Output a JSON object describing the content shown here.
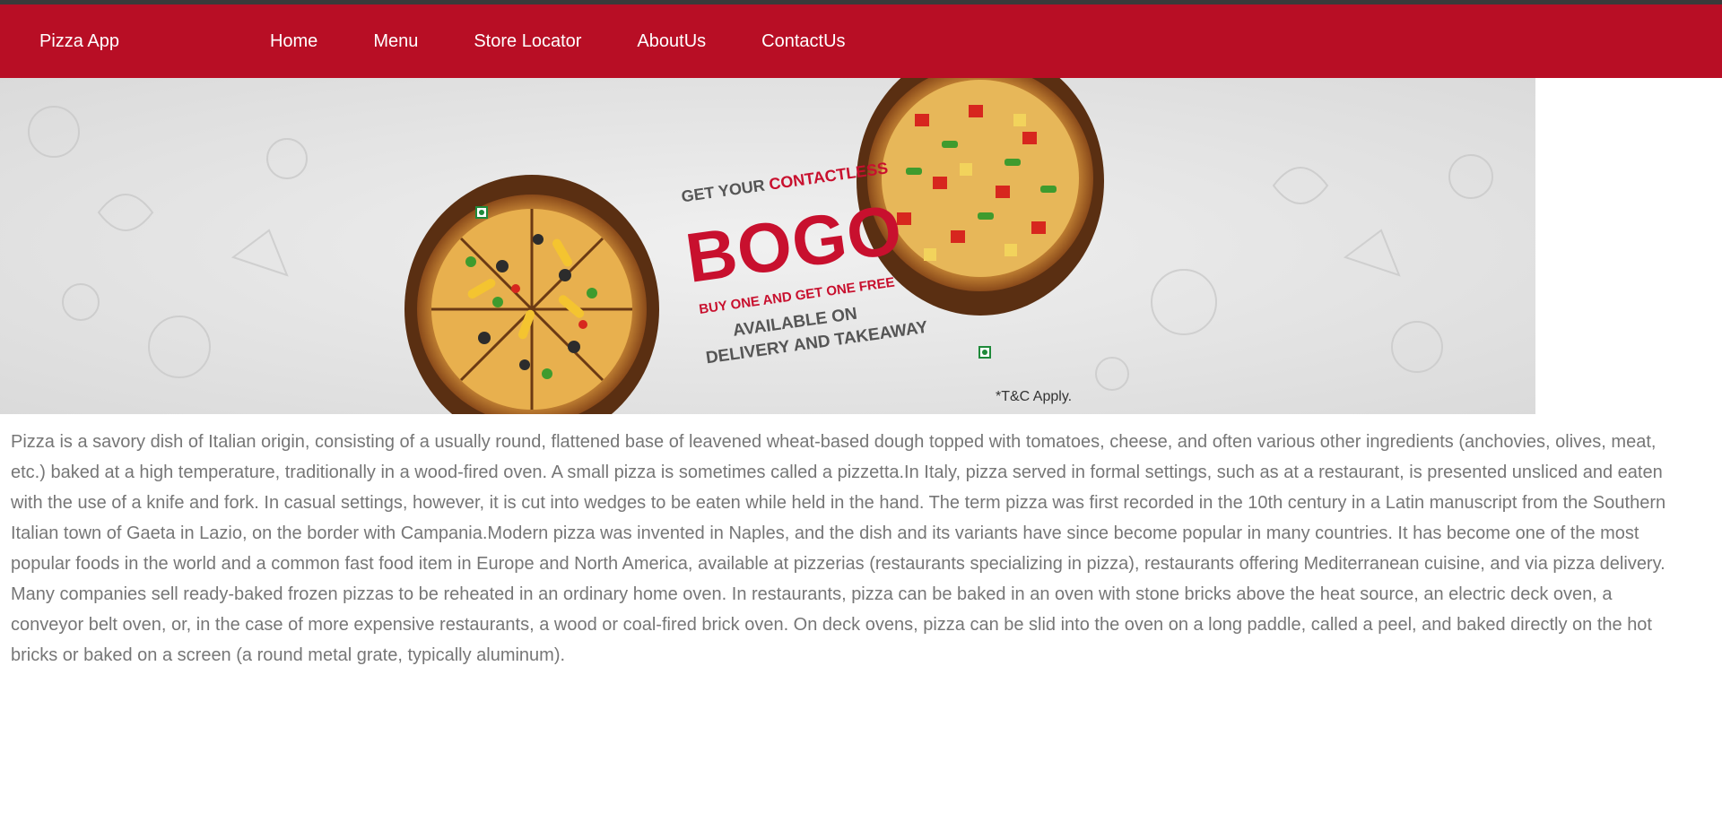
{
  "nav": {
    "brand": "Pizza App",
    "links": [
      "Home",
      "Menu",
      "Store Locator",
      "AboutUs",
      "ContactUs"
    ]
  },
  "banner": {
    "line1_a": "GET YOUR",
    "line1_b": "CONTACTLESS",
    "headline": "BOGO",
    "subline": "BUY ONE AND GET ONE FREE",
    "avail1": "AVAILABLE ON",
    "avail2": "DELIVERY AND TAKEAWAY",
    "tc": "*T&C Apply."
  },
  "article": {
    "text": "Pizza is a savory dish of Italian origin, consisting of a usually round, flattened base of leavened wheat-based dough topped with tomatoes, cheese, and often various other ingredients (anchovies, olives, meat, etc.) baked at a high temperature, traditionally in a wood-fired oven. A small pizza is sometimes called a pizzetta.In Italy, pizza served in formal settings, such as at a restaurant, is presented unsliced and eaten with the use of a knife and fork. In casual settings, however, it is cut into wedges to be eaten while held in the hand. The term pizza was first recorded in the 10th century in a Latin manuscript from the Southern Italian town of Gaeta in Lazio, on the border with Campania.Modern pizza was invented in Naples, and the dish and its variants have since become popular in many countries. It has become one of the most popular foods in the world and a common fast food item in Europe and North America, available at pizzerias (restaurants specializing in pizza), restaurants offering Mediterranean cuisine, and via pizza delivery. Many companies sell ready-baked frozen pizzas to be reheated in an ordinary home oven. In restaurants, pizza can be baked in an oven with stone bricks above the heat source, an electric deck oven, a conveyor belt oven, or, in the case of more expensive restaurants, a wood or coal-fired brick oven. On deck ovens, pizza can be slid into the oven on a long paddle, called a peel, and baked directly on the hot bricks or baked on a screen (a round metal grate, typically aluminum)."
  },
  "colors": {
    "nav_bg": "#b80e25",
    "text_gray": "#767676",
    "banner_red": "#c8102e"
  }
}
